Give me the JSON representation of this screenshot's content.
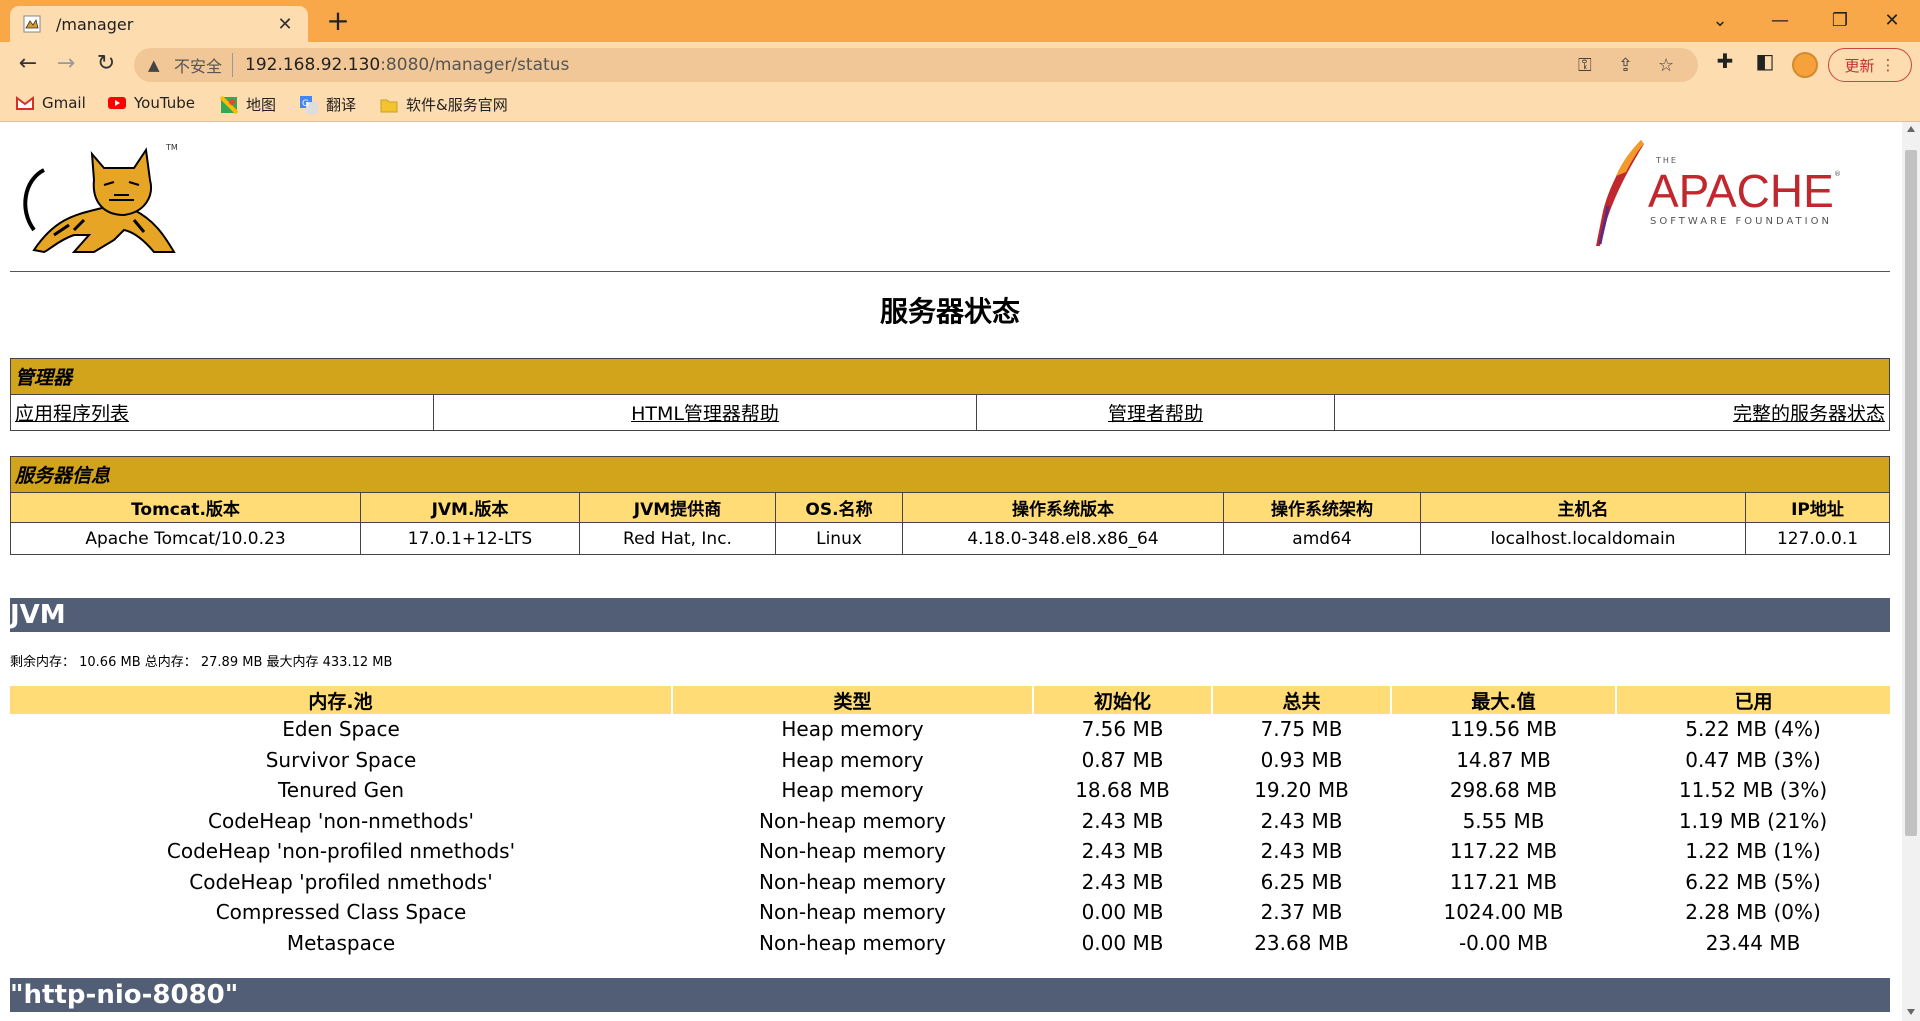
{
  "browser": {
    "tab_title": "/manager",
    "insecure_label": "不安全",
    "url_host": "192.168.92.130",
    "url_path": ":8080/manager/status",
    "update_label": "更新",
    "bookmarks": [
      {
        "label": "Gmail",
        "icon": "gmail-icon"
      },
      {
        "label": "YouTube",
        "icon": "youtube-icon"
      },
      {
        "label": "地图",
        "icon": "maps-icon"
      },
      {
        "label": "翻译",
        "icon": "translate-icon"
      },
      {
        "label": "软件&服务官网",
        "icon": "folder-icon"
      }
    ]
  },
  "page": {
    "title": "服务器状态",
    "apache_the": "THE",
    "apache_word": "APACHE",
    "apache_sub": "SOFTWARE FOUNDATION",
    "manager": {
      "heading": "管理器",
      "links": [
        "应用程序列表",
        "HTML管理器帮助",
        "管理者帮助",
        "完整的服务器状态"
      ]
    },
    "server_info": {
      "heading": "服务器信息",
      "columns": [
        "Tomcat.版本",
        "JVM.版本",
        "JVM提供商",
        "OS.名称",
        "操作系统版本",
        "操作系统架构",
        "主机名",
        "IP地址"
      ],
      "values": [
        "Apache Tomcat/10.0.23",
        "17.0.1+12-LTS",
        "Red Hat, Inc.",
        "Linux",
        "4.18.0-348.el8.x86_64",
        "amd64",
        "localhost.localdomain",
        "127.0.0.1"
      ]
    },
    "jvm": {
      "heading": "JVM",
      "memory_summary": "剩余内存：  10.66 MB 总内存：  27.89 MB 最大内存 433.12 MB",
      "columns": [
        "内存.池",
        "类型",
        "初始化",
        "总共",
        "最大.值",
        "已用"
      ],
      "rows": [
        [
          "Eden Space",
          "Heap memory",
          "7.56 MB",
          "7.75 MB",
          "119.56 MB",
          "5.22 MB (4%)"
        ],
        [
          "Survivor Space",
          "Heap memory",
          "0.87 MB",
          "0.93 MB",
          "14.87 MB",
          "0.47 MB (3%)"
        ],
        [
          "Tenured Gen",
          "Heap memory",
          "18.68 MB",
          "19.20 MB",
          "298.68 MB",
          "11.52 MB (3%)"
        ],
        [
          "CodeHeap 'non-nmethods'",
          "Non-heap memory",
          "2.43 MB",
          "2.43 MB",
          "5.55 MB",
          "1.19 MB (21%)"
        ],
        [
          "CodeHeap 'non-profiled nmethods'",
          "Non-heap memory",
          "2.43 MB",
          "2.43 MB",
          "117.22 MB",
          "1.22 MB (1%)"
        ],
        [
          "CodeHeap 'profiled nmethods'",
          "Non-heap memory",
          "2.43 MB",
          "6.25 MB",
          "117.21 MB",
          "6.22 MB (5%)"
        ],
        [
          "Compressed Class Space",
          "Non-heap memory",
          "0.00 MB",
          "2.37 MB",
          "1024.00 MB",
          "2.28 MB (0%)"
        ],
        [
          "Metaspace",
          "Non-heap memory",
          "0.00 MB",
          "23.68 MB",
          "-0.00 MB",
          "23.44 MB"
        ]
      ]
    },
    "connector_heading": "\"http-nio-8080\""
  },
  "colors": {
    "tabbar": "#f8a848",
    "toolbar": "#fddcb0",
    "section_header": "#d2a41c",
    "column_header": "#ffdc75",
    "jvm_bar": "#525d76",
    "apache_red": "#c0282e"
  }
}
